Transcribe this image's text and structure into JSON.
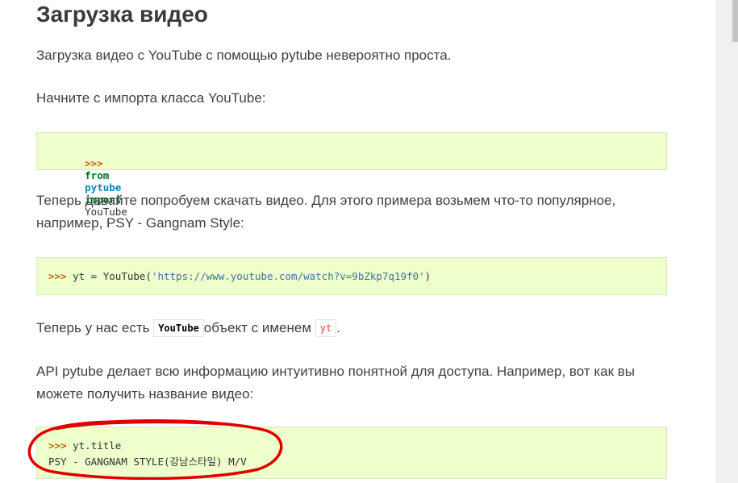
{
  "heading": "Загрузка видео",
  "paragraphs": {
    "intro": "Загрузка видео с YouTube с помощью pytube невероятно проста.",
    "import_hint": "Начните с импорта класса YouTube:",
    "download_hint": "Теперь давайте попробуем скачать видео. Для этого примера возьмем что-то популярное, например, PSY - Gangnam Style:",
    "object_prefix": "Теперь у нас есть",
    "object_class": "YouTube",
    "object_middle": "объект с именем",
    "object_var": "yt",
    "object_suffix": ".",
    "api_hint": "API pytube делает всю информацию интуитивно понятной для доступа. Например, вот как вы можете получить название видео:"
  },
  "code_blocks": {
    "import": {
      "prompt": ">>>",
      "keyword_from": "from",
      "module": "pytube",
      "keyword_import": "import",
      "name": "YouTube"
    },
    "create": {
      "prompt": ">>>",
      "prefix": "yt = YouTube(",
      "string": "'https://www.youtube.com/watch?v=9bZkp7q19f0'",
      "suffix": ")"
    },
    "title": {
      "prompt": ">>>",
      "code": "yt.title",
      "output": "PSY - GANGNAM STYLE(강남스타일) M/V"
    }
  },
  "colors": {
    "code_background": "#eeffcc",
    "prompt": "#c65d09",
    "keyword": "#007020",
    "module": "#0e84b5",
    "string": "#4070a0",
    "annotation": "#e00000"
  }
}
